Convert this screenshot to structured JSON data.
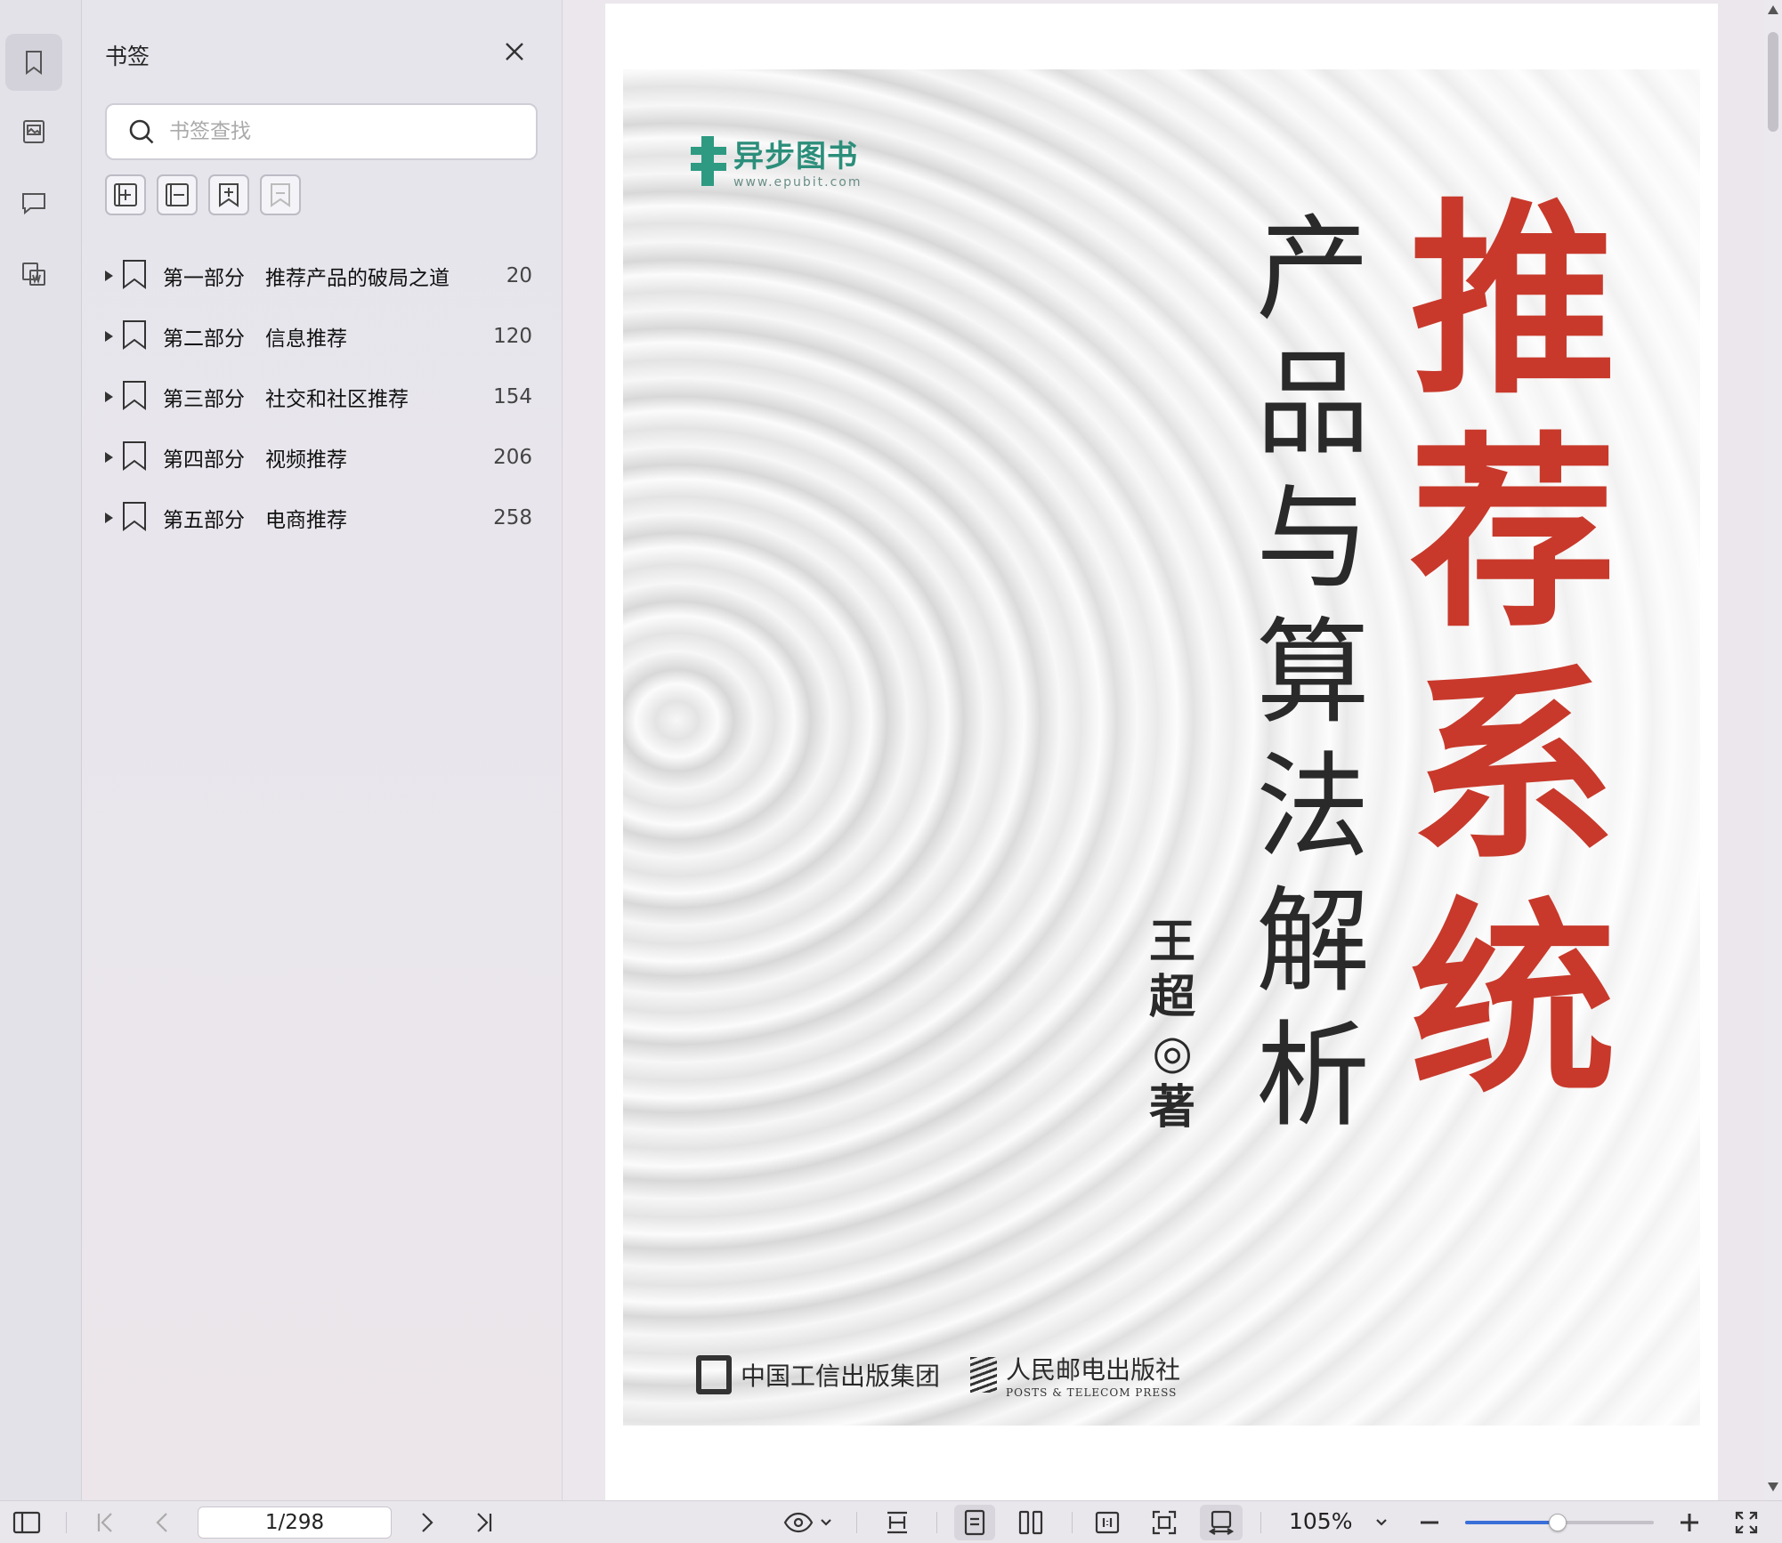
{
  "panel": {
    "title": "书签",
    "search_placeholder": "书签查找"
  },
  "bookmarks": [
    {
      "label": "第一部分　推荐产品的破局之道",
      "page": "20"
    },
    {
      "label": "第二部分　信息推荐",
      "page": "120"
    },
    {
      "label": "第三部分　社交和社区推荐",
      "page": "154"
    },
    {
      "label": "第四部分　视频推荐",
      "page": "206"
    },
    {
      "label": "第五部分　电商推荐",
      "page": "258"
    }
  ],
  "cover": {
    "publisher_logo_cn": "异步图书",
    "publisher_logo_url": "www.epubit.com",
    "title_chars": [
      "推",
      "荐",
      "系",
      "统"
    ],
    "subtitle_chars": [
      "产",
      "品",
      "与",
      "算",
      "法",
      "解",
      "析"
    ],
    "author_chars": [
      "王",
      "超",
      "◎",
      "著"
    ],
    "group_name": "中国工信出版集团",
    "press_name_cn": "人民邮电出版社",
    "press_name_en": "POSTS & TELECOM PRESS"
  },
  "toolbar": {
    "page_indicator": "1/298",
    "zoom": "105%",
    "zoom_slider_fraction": 0.49
  },
  "colors": {
    "title_red": "#c8392b",
    "brand_green": "#2e9a82",
    "slider_blue": "#3a6fd8"
  }
}
